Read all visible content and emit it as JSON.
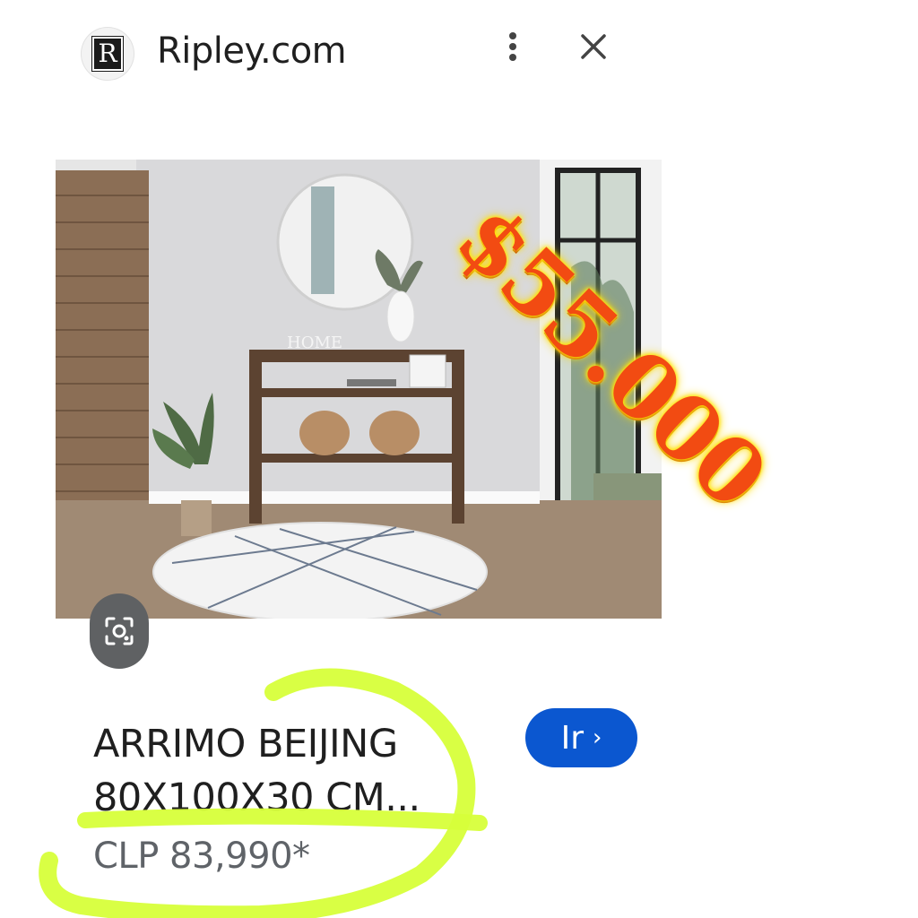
{
  "header": {
    "favicon_letter": "R",
    "site_name": "Ripley.com",
    "more_icon": "more-vertical-icon",
    "close_icon": "close-icon"
  },
  "image": {
    "sign_text": "HOME",
    "lens_icon": "image-search-icon"
  },
  "overlay": {
    "price_stamp": "$55.000",
    "stamp_color": "#f24b12",
    "stamp_glow": "#ffe600",
    "highlight_color": "#d7ff3a"
  },
  "product": {
    "title_line1": "ARRIMO BEIJING",
    "title_line2": "80X100X30 CM...",
    "price": "CLP 83,990*"
  },
  "actions": {
    "go_label": "Ir",
    "go_chevron": "›",
    "accent": "#0b57d0"
  }
}
